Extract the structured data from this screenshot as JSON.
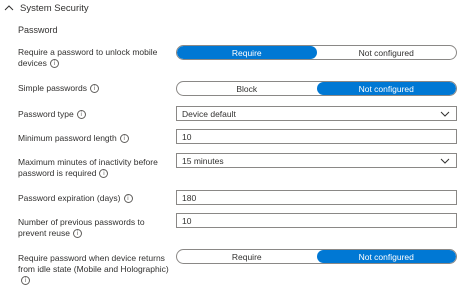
{
  "section": {
    "title": "System Security"
  },
  "group": {
    "title": "Password"
  },
  "rows": [
    {
      "label": "Require a password to unlock mobile devices",
      "type": "toggle",
      "options": [
        "Require",
        "Not configured"
      ],
      "selected": 0
    },
    {
      "label": "Simple passwords",
      "type": "toggle",
      "options": [
        "Block",
        "Not configured"
      ],
      "selected": 1
    },
    {
      "label": "Password type",
      "type": "select",
      "value": "Device default"
    },
    {
      "label": "Minimum password length",
      "type": "input",
      "value": "10"
    },
    {
      "label": "Maximum minutes of inactivity before password is required",
      "type": "select",
      "value": "15 minutes"
    },
    {
      "label": "Password expiration (days)",
      "type": "input",
      "value": "180"
    },
    {
      "label": "Number of previous passwords to prevent reuse",
      "type": "input",
      "value": "10"
    },
    {
      "label": "Require password when device returns from idle state (Mobile and Holographic)",
      "type": "toggle",
      "options": [
        "Require",
        "Not configured"
      ],
      "selected": 1
    }
  ],
  "icons": {
    "info": "info-icon",
    "collapse": "chevron-up-icon",
    "dropdown": "chevron-down-icon"
  },
  "colors": {
    "accent": "#0078d4",
    "border": "#8a8886",
    "text": "#323130"
  }
}
